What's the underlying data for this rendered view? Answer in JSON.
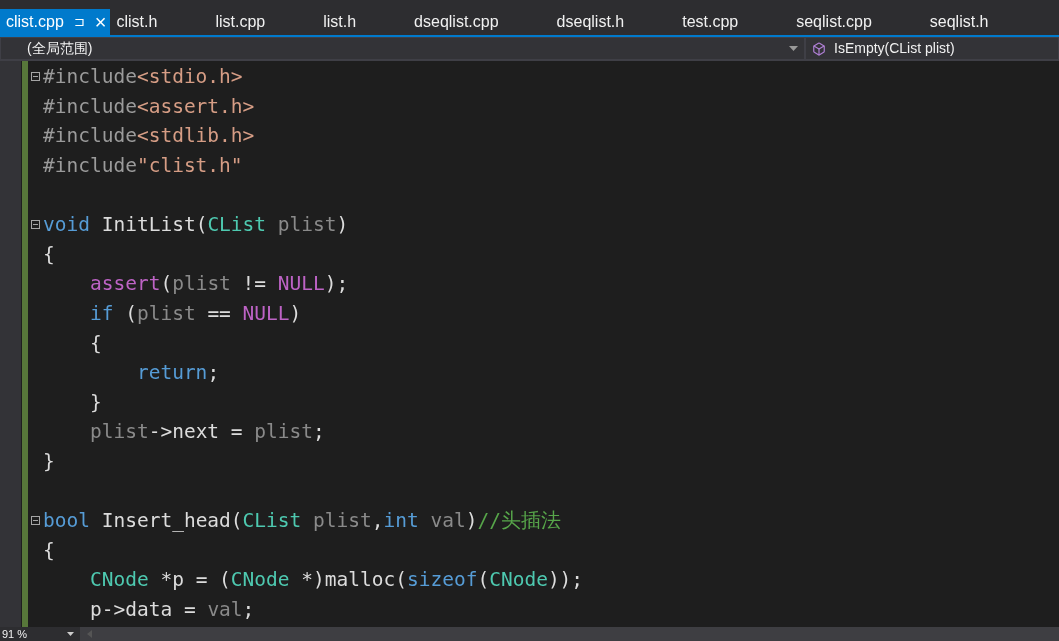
{
  "tabs": [
    {
      "label": "clist.cpp",
      "selected": true,
      "pin": "⊐",
      "close": "×"
    },
    {
      "label": "clist.h",
      "selected": false
    },
    {
      "label": "list.cpp",
      "selected": false
    },
    {
      "label": "list.h",
      "selected": false
    },
    {
      "label": "dseqlist.cpp",
      "selected": false
    },
    {
      "label": "dseqlist.h",
      "selected": false
    },
    {
      "label": "test.cpp",
      "selected": false
    },
    {
      "label": "seqlist.cpp",
      "selected": false
    },
    {
      "label": "seqlist.h",
      "selected": false
    }
  ],
  "navigation": {
    "scope": "(全局范围)",
    "member": "IsEmpty(CList plist)"
  },
  "code_lines": [
    {
      "fold": true,
      "tokens": [
        {
          "kind": "preprocessor",
          "text": "#include"
        },
        {
          "kind": "string",
          "text": "<stdio.h>"
        }
      ]
    },
    {
      "fold": false,
      "tokens": [
        {
          "kind": "preprocessor",
          "text": "#include"
        },
        {
          "kind": "string",
          "text": "<assert.h>"
        }
      ]
    },
    {
      "fold": false,
      "tokens": [
        {
          "kind": "preprocessor",
          "text": "#include"
        },
        {
          "kind": "string",
          "text": "<stdlib.h>"
        }
      ]
    },
    {
      "fold": false,
      "tokens": [
        {
          "kind": "preprocessor",
          "text": "#include"
        },
        {
          "kind": "string",
          "text": "\"clist.h\""
        }
      ]
    },
    {
      "fold": false
    },
    {
      "fold": true,
      "tokens": [
        {
          "kind": "keyword",
          "text": "void"
        },
        {
          "kind": "plain",
          "text": " InitList("
        },
        {
          "kind": "type",
          "text": "CList"
        },
        {
          "kind": "param",
          "text": " plist"
        },
        {
          "kind": "plain",
          "text": ")"
        }
      ]
    },
    {
      "fold": false,
      "tokens": [
        {
          "kind": "plain",
          "text": "{"
        }
      ]
    },
    {
      "fold": false,
      "tokens": [
        {
          "kind": "macro",
          "text": "    assert"
        },
        {
          "kind": "plain",
          "text": "("
        },
        {
          "kind": "param",
          "text": "plist"
        },
        {
          "kind": "plain",
          "text": " != "
        },
        {
          "kind": "macro",
          "text": "NULL"
        },
        {
          "kind": "plain",
          "text": ");"
        }
      ]
    },
    {
      "fold": false,
      "tokens": [
        {
          "kind": "keyword",
          "text": "    if"
        },
        {
          "kind": "plain",
          "text": " ("
        },
        {
          "kind": "param",
          "text": "plist"
        },
        {
          "kind": "plain",
          "text": " == "
        },
        {
          "kind": "macro",
          "text": "NULL"
        },
        {
          "kind": "plain",
          "text": ")"
        }
      ]
    },
    {
      "fold": false,
      "tokens": [
        {
          "kind": "plain",
          "text": "    {"
        }
      ]
    },
    {
      "fold": false,
      "tokens": [
        {
          "kind": "keyword",
          "text": "        return"
        },
        {
          "kind": "plain",
          "text": ";"
        }
      ]
    },
    {
      "fold": false,
      "tokens": [
        {
          "kind": "plain",
          "text": "    }"
        }
      ]
    },
    {
      "fold": false,
      "tokens": [
        {
          "kind": "param",
          "text": "    plist"
        },
        {
          "kind": "plain",
          "text": "->next = "
        },
        {
          "kind": "param",
          "text": "plist"
        },
        {
          "kind": "plain",
          "text": ";"
        }
      ]
    },
    {
      "fold": false,
      "tokens": [
        {
          "kind": "plain",
          "text": "}"
        }
      ]
    },
    {
      "fold": false
    },
    {
      "fold": true,
      "tokens": [
        {
          "kind": "keyword",
          "text": "bool"
        },
        {
          "kind": "plain",
          "text": " Insert_head("
        },
        {
          "kind": "type",
          "text": "CList"
        },
        {
          "kind": "param",
          "text": " plist"
        },
        {
          "kind": "plain",
          "text": ","
        },
        {
          "kind": "keyword",
          "text": "int"
        },
        {
          "kind": "param",
          "text": " val"
        },
        {
          "kind": "plain",
          "text": ")"
        },
        {
          "kind": "comment",
          "text": "//头插法"
        }
      ]
    },
    {
      "fold": false,
      "tokens": [
        {
          "kind": "plain",
          "text": "{"
        }
      ]
    },
    {
      "fold": false,
      "tokens": [
        {
          "kind": "type",
          "text": "    CNode"
        },
        {
          "kind": "plain",
          "text": " *p = ("
        },
        {
          "kind": "type",
          "text": "CNode"
        },
        {
          "kind": "plain",
          "text": " *)malloc("
        },
        {
          "kind": "keyword",
          "text": "sizeof"
        },
        {
          "kind": "plain",
          "text": "("
        },
        {
          "kind": "type",
          "text": "CNode"
        },
        {
          "kind": "plain",
          "text": "));"
        }
      ]
    },
    {
      "fold": false,
      "tokens": [
        {
          "kind": "plain",
          "text": "    p->data = "
        },
        {
          "kind": "param",
          "text": "val"
        },
        {
          "kind": "plain",
          "text": ";"
        }
      ]
    }
  ],
  "status_bar": {
    "zoom": "91 %"
  }
}
